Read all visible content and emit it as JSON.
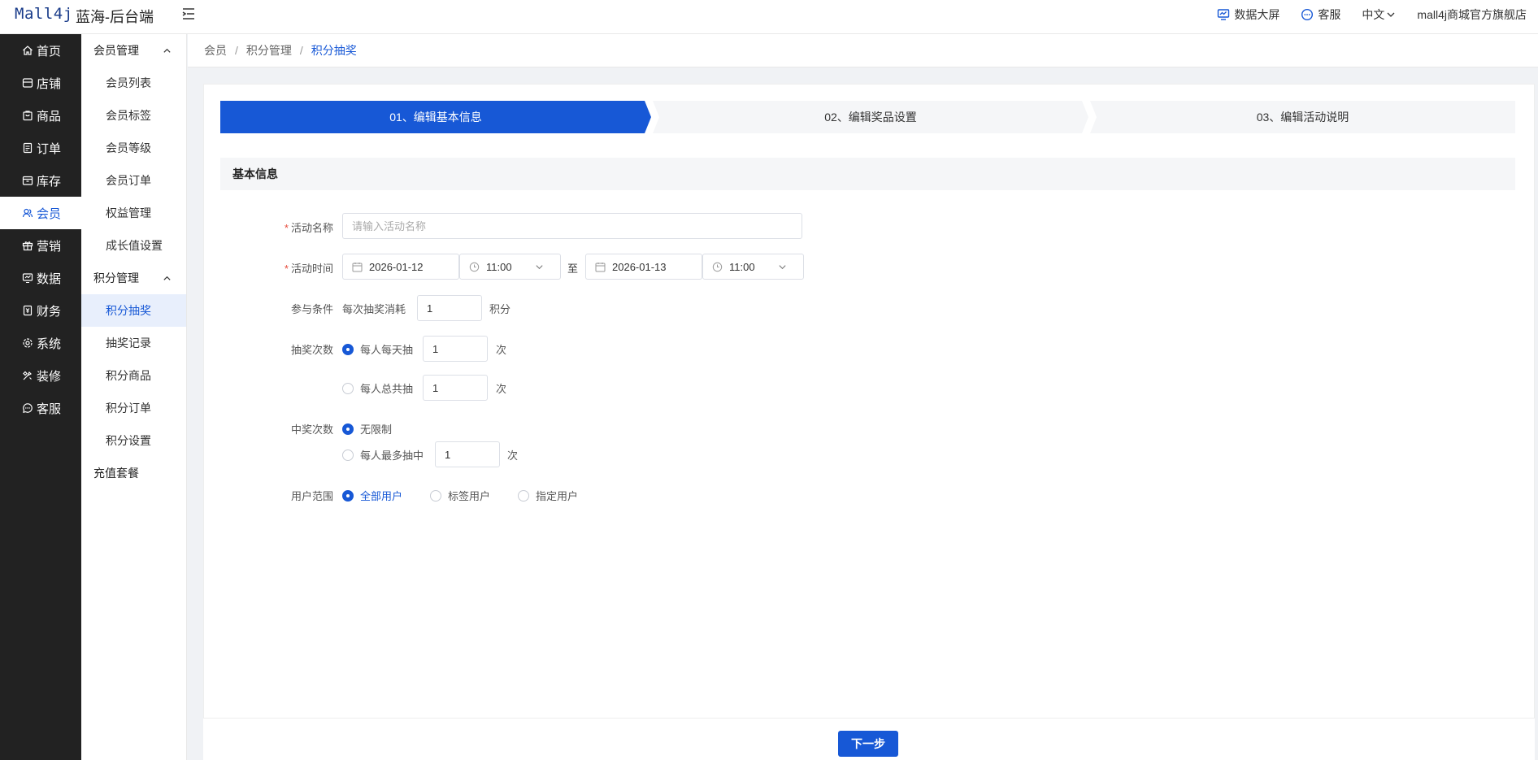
{
  "header": {
    "logo": "Mall4j",
    "app_title": "蓝海-后台端",
    "data_screen": "数据大屏",
    "service": "客服",
    "language": "中文",
    "shop_name": "mall4j商城官方旗舰店"
  },
  "sidebar": {
    "items": [
      {
        "label": "首页",
        "icon": "home-icon"
      },
      {
        "label": "店铺",
        "icon": "store-icon"
      },
      {
        "label": "商品",
        "icon": "goods-icon"
      },
      {
        "label": "订单",
        "icon": "order-icon"
      },
      {
        "label": "库存",
        "icon": "inventory-icon"
      },
      {
        "label": "会员",
        "icon": "member-icon"
      },
      {
        "label": "营销",
        "icon": "gift-icon"
      },
      {
        "label": "数据",
        "icon": "chart-icon"
      },
      {
        "label": "财务",
        "icon": "finance-icon"
      },
      {
        "label": "系统",
        "icon": "gear-icon"
      },
      {
        "label": "装修",
        "icon": "decorate-icon"
      },
      {
        "label": "客服",
        "icon": "chat-icon"
      }
    ],
    "active": "会员"
  },
  "submenu": {
    "group1": "会员管理",
    "group1_items": [
      "会员列表",
      "会员标签",
      "会员等级",
      "会员订单",
      "权益管理",
      "成长值设置"
    ],
    "group2": "积分管理",
    "group2_items": [
      "积分抽奖",
      "抽奖记录",
      "积分商品",
      "积分订单",
      "积分设置"
    ],
    "extra": "充值套餐",
    "active": "积分抽奖"
  },
  "breadcrumb": {
    "items": [
      "会员",
      "积分管理",
      "积分抽奖"
    ],
    "separator": "/"
  },
  "steps": [
    "01、编辑基本信息",
    "02、编辑奖品设置",
    "03、编辑活动说明"
  ],
  "active_step": 0,
  "section_title": "基本信息",
  "form": {
    "name_label": "活动名称",
    "name_placeholder": "请输入活动名称",
    "time_label": "活动时间",
    "start_date": "2026-01-12",
    "start_time": "11:00",
    "to": "至",
    "end_date": "2026-01-13",
    "end_time": "11:00",
    "cond_label": "参与条件",
    "cond_prefix": "每次抽奖消耗",
    "cond_value": "1",
    "cond_unit": "积分",
    "draw_label": "抽奖次数",
    "draw_daily": "每人每天抽",
    "draw_daily_value": "1",
    "draw_total": "每人总共抽",
    "draw_total_value": "1",
    "times_unit": "次",
    "win_label": "中奖次数",
    "win_unlimited": "无限制",
    "win_max": "每人最多抽中",
    "win_max_value": "1",
    "scope_label": "用户范围",
    "scope_all": "全部用户",
    "scope_tag": "标签用户",
    "scope_specified": "指定用户"
  },
  "footer": {
    "next": "下一步"
  },
  "colors": {
    "primary": "#1758d6",
    "sidebar_bg": "#222222",
    "required": "#e74c3c"
  }
}
